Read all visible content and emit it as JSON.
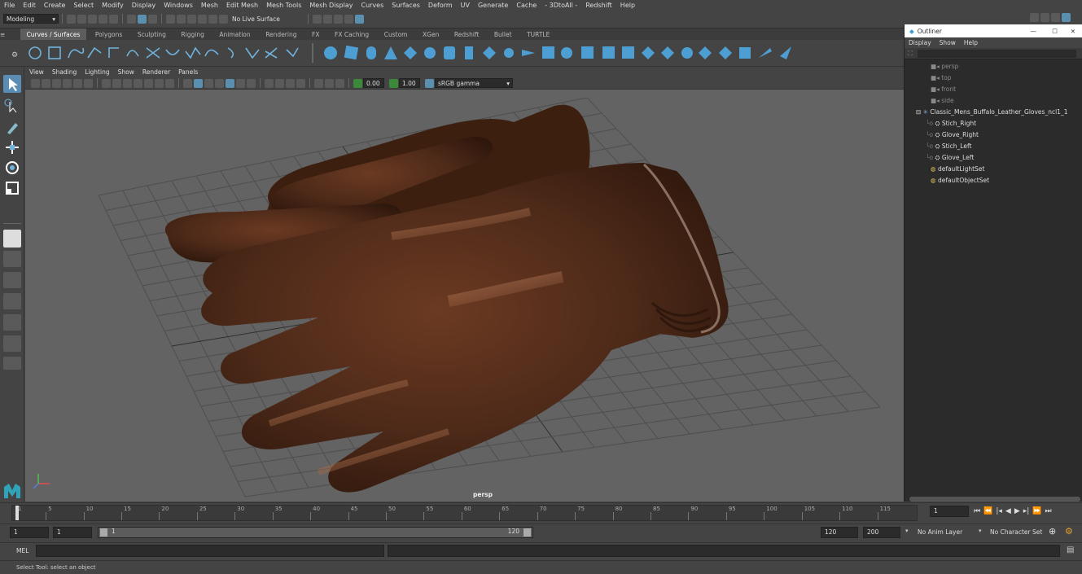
{
  "menubar": [
    "File",
    "Edit",
    "Create",
    "Select",
    "Modify",
    "Display",
    "Windows",
    "Mesh",
    "Edit Mesh",
    "Mesh Tools",
    "Mesh Display",
    "Curves",
    "Surfaces",
    "Deform",
    "UV",
    "Generate",
    "Cache",
    "- 3DtoAll -",
    "Redshift",
    "Help"
  ],
  "status": {
    "workspace": "Modeling",
    "live_surface": "No Live Surface"
  },
  "shelf_tabs": [
    "Curves / Surfaces",
    "Polygons",
    "Sculpting",
    "Rigging",
    "Animation",
    "Rendering",
    "FX",
    "FX Caching",
    "Custom",
    "XGen",
    "Redshift",
    "Bullet",
    "TURTLE"
  ],
  "panel_menu": [
    "View",
    "Shading",
    "Lighting",
    "Show",
    "Renderer",
    "Panels"
  ],
  "panel_tools": {
    "exposure": "0.00",
    "gamma": "1.00",
    "color_space": "sRGB gamma"
  },
  "viewport": {
    "camera_label": "persp"
  },
  "outliner": {
    "title": "Outliner",
    "menu": [
      "Display",
      "Show",
      "Help"
    ],
    "items": [
      {
        "label": "persp",
        "type": "camera"
      },
      {
        "label": "top",
        "type": "camera"
      },
      {
        "label": "front",
        "type": "camera"
      },
      {
        "label": "side",
        "type": "camera"
      },
      {
        "label": "Classic_Mens_Buffalo_Leather_Gloves_ncl1_1",
        "type": "group"
      },
      {
        "label": "Stich_Right",
        "type": "mesh"
      },
      {
        "label": "Glove_Right",
        "type": "mesh"
      },
      {
        "label": "Stich_Left",
        "type": "mesh"
      },
      {
        "label": "Glove_Left",
        "type": "mesh"
      },
      {
        "label": "defaultLightSet",
        "type": "set"
      },
      {
        "label": "defaultObjectSet",
        "type": "set"
      }
    ]
  },
  "timeline": {
    "ticks": [
      "1",
      "5",
      "10",
      "15",
      "20",
      "25",
      "30",
      "35",
      "40",
      "45",
      "50",
      "55",
      "60",
      "65",
      "70",
      "75",
      "80",
      "85",
      "90",
      "95",
      "100",
      "105",
      "110",
      "115"
    ],
    "current_frame": "1"
  },
  "range": {
    "start": "1",
    "playback_start": "1",
    "range_start_label": "1",
    "range_end_label": "120",
    "playback_end": "120",
    "end": "200",
    "anim_layer": "No Anim Layer",
    "character_set": "No Character Set"
  },
  "cmd": {
    "label": "MEL"
  },
  "help": {
    "text": "Select Tool: select an object"
  },
  "colors": {
    "accent": "#5b8db4",
    "glove": "#4e2a19",
    "viewport_bg": "#636363"
  }
}
